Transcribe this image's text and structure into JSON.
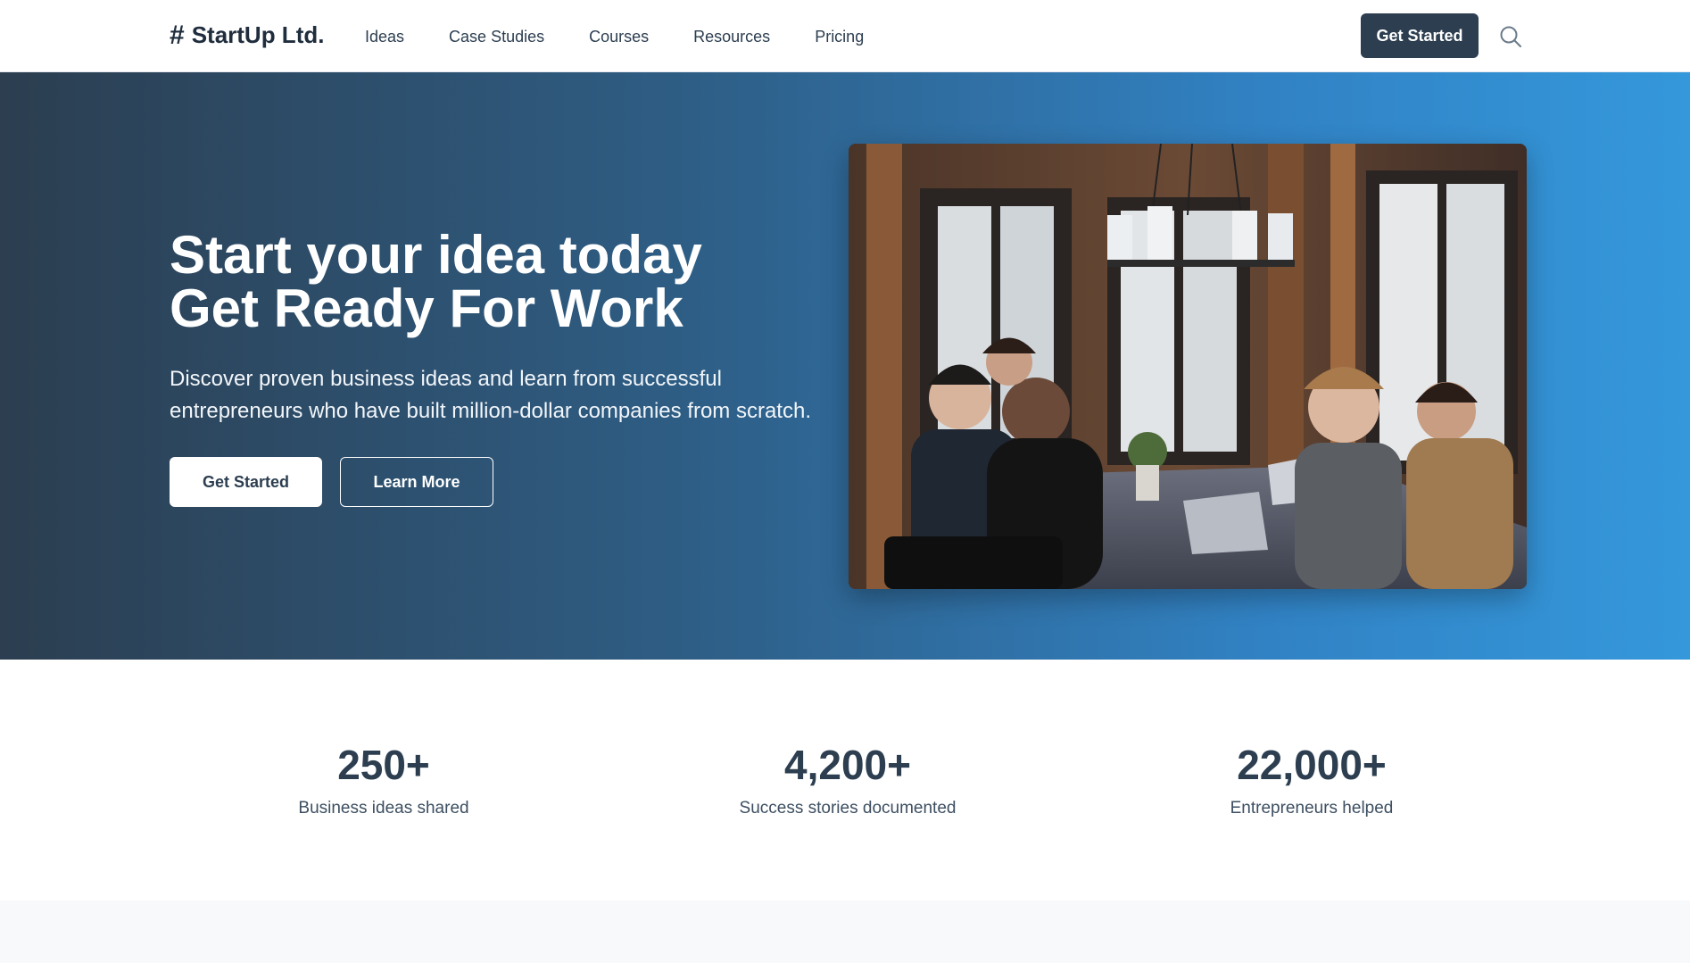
{
  "brand": {
    "symbol": "#",
    "name": "StartUp Ltd."
  },
  "nav": {
    "items": [
      "Ideas",
      "Case Studies",
      "Courses",
      "Resources",
      "Pricing"
    ],
    "cta_label": "Get Started",
    "search_icon": "search-icon"
  },
  "hero": {
    "title_line1": "Start your idea today",
    "title_line2": "Get Ready For Work",
    "description": "Discover proven business ideas and learn from successful entrepreneurs who have built million-dollar companies from scratch.",
    "primary_button": "Get Started",
    "secondary_button": "Learn More",
    "gradient_start": "#2c3e50",
    "gradient_end": "#3498db"
  },
  "stats": [
    {
      "value": "250+",
      "label": "Business ideas shared"
    },
    {
      "value": "4,200+",
      "label": "Success stories documented"
    },
    {
      "value": "22,000+",
      "label": "Entrepreneurs helped"
    }
  ],
  "colors": {
    "primary": "#2c3e50",
    "accent": "#3498db"
  }
}
